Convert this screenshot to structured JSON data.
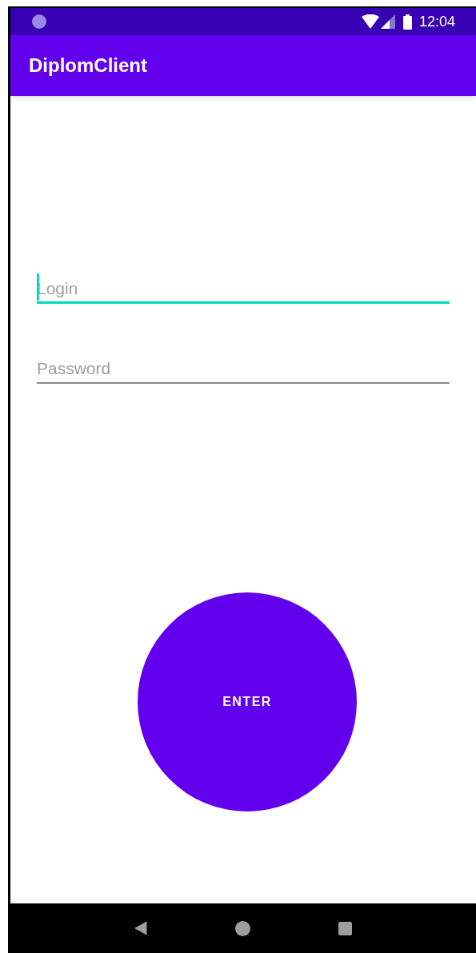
{
  "status_bar": {
    "time": "12:04"
  },
  "app_bar": {
    "title": "DiplomClient"
  },
  "fields": [
    {
      "placeholder": "Login",
      "focused": true
    },
    {
      "placeholder": "Password",
      "focused": false
    }
  ],
  "button": {
    "label": "ENTER"
  }
}
